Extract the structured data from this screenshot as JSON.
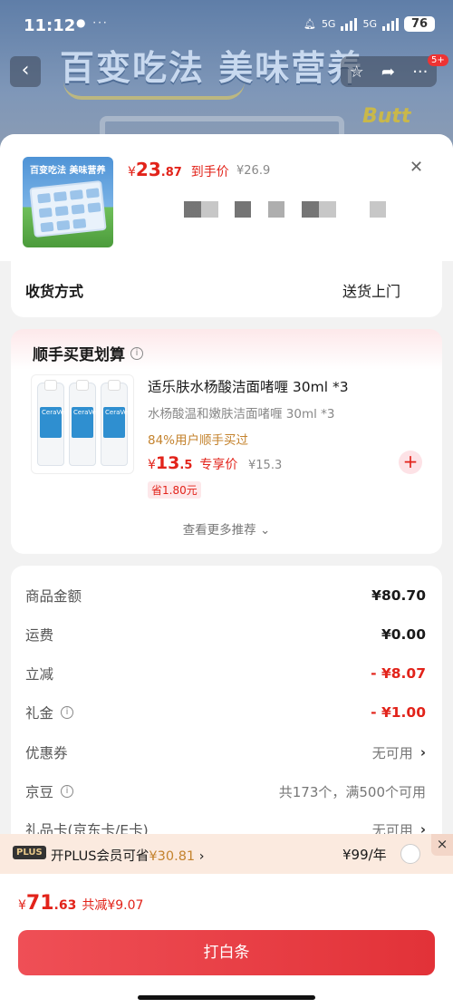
{
  "status_bar": {
    "time": "11:12",
    "net1": "5G",
    "net2": "5G",
    "battery": "76"
  },
  "background_page": {
    "banner_text": "百变吃法 美味营养",
    "brand_tag": "Butt",
    "badge": "5+"
  },
  "product": {
    "thumb_title": "百变吃法 美味营养",
    "price_yen": "¥",
    "price_int": "23",
    "price_dec": ".87",
    "price_tag": "到手价",
    "original_price": "¥26.9"
  },
  "delivery": {
    "label": "收货方式",
    "value": "送货上门"
  },
  "recommend": {
    "title": "顺手买更划算",
    "name": "适乐肤水杨酸洁面啫喱 30ml *3",
    "subtitle": "水杨酸温和嫩肤洁面啫喱 30ml *3",
    "buy_rate": "84%用户顺手买过",
    "price_yen": "¥",
    "price_int": "13",
    "price_dec": ".5",
    "price_tag": "专享价",
    "original_price": "¥15.3",
    "save": "省1.80元",
    "bottle_label": "CeraVe",
    "more": "查看更多推荐"
  },
  "summary": {
    "rows": [
      {
        "label": "商品金额",
        "value": "¥80.70"
      },
      {
        "label": "运费",
        "value": "¥0.00"
      },
      {
        "label": "立减",
        "value": "- ¥8.07"
      },
      {
        "label": "礼金",
        "value": "- ¥1.00"
      },
      {
        "label": "优惠券",
        "value": "无可用"
      },
      {
        "label": "京豆",
        "value": "共173个，满500个可用"
      },
      {
        "label": "礼品卡(京东卡/E卡)",
        "value": "无可用"
      }
    ]
  },
  "plus_bar": {
    "badge": "PLUS",
    "text_prefix": "开PLUS会员可省",
    "amount": "¥30.81",
    "arrow": "›",
    "price": "¥99/年",
    "close": "×"
  },
  "footer": {
    "total_yen": "¥",
    "total_int": "71",
    "total_dec": ".63",
    "reduced": "共减¥9.07",
    "pay_button": "打白条"
  },
  "colors": {
    "accent": "#e2231a",
    "plus_gold": "#c4832e",
    "pay_button": "#e8383e"
  }
}
